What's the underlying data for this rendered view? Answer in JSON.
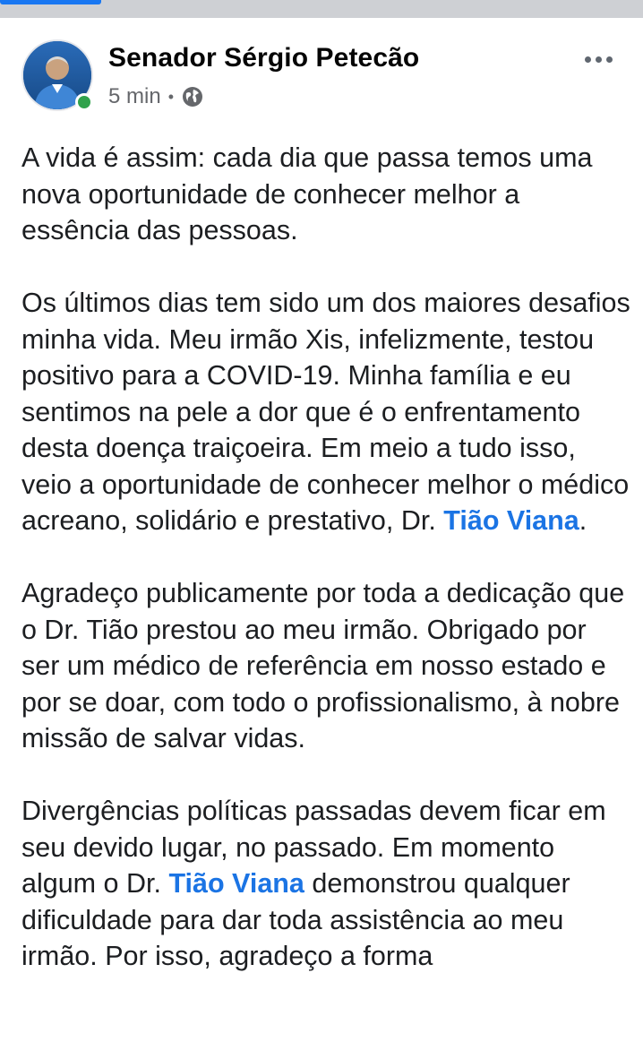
{
  "post": {
    "author": "Senador Sérgio Petecão",
    "time": "5 min",
    "separator": "•",
    "privacy_icon": "globe-icon",
    "more_icon": "more-horizontal-icon",
    "status_color": "#31a24c",
    "link_color": "#1b74e4"
  },
  "body": {
    "p1": "A vida é assim: cada dia que passa temos uma nova oportunidade de conhecer melhor a essência das pessoas.",
    "p2_before": "Os últimos dias tem sido um dos maiores desafios minha vida. Meu irmão Xis, infelizmente, testou positivo para a COVID-19. Minha família e eu sentimos na pele a dor que é o enfrentamento desta doença traiçoeira. Em meio a tudo isso, veio a oportunidade de conhecer melhor o médico acreano, solidário e prestativo, Dr. ",
    "p2_mention": "Tião Viana",
    "p2_after": ".",
    "p3": "Agradeço publicamente por toda a dedicação que o Dr. Tião prestou ao meu irmão. Obrigado por ser um médico de referência em nosso estado e por se doar, com todo o profissionalismo, à nobre missão de salvar vidas.",
    "p4_before": "Divergências políticas passadas devem ficar em seu devido lugar, no passado. Em momento algum o Dr. ",
    "p4_mention": "Tião Viana",
    "p4_after": " demonstrou qualquer dificuldade para dar toda assistência ao meu irmão. Por isso, agradeço a forma"
  }
}
